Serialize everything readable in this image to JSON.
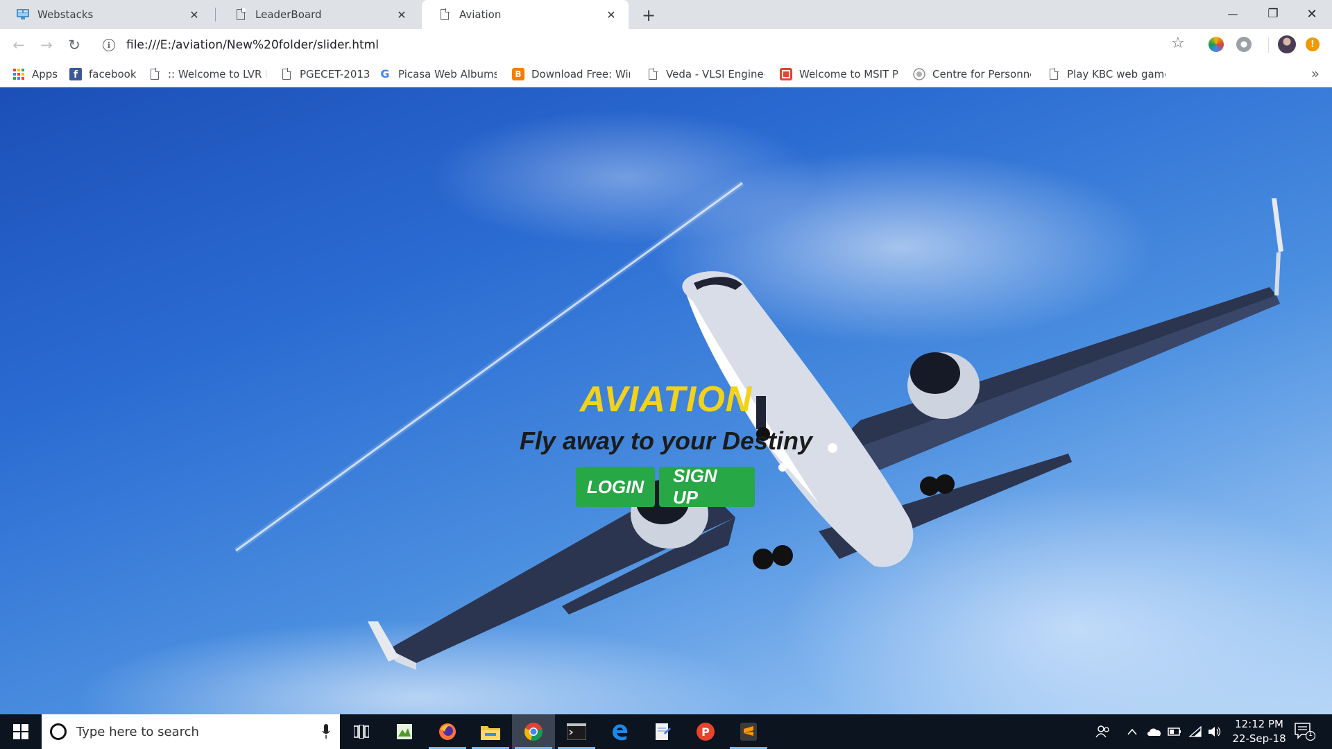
{
  "browser": {
    "tabs": [
      {
        "title": "Webstacks",
        "icon": "webstacks-favicon",
        "active": false
      },
      {
        "title": "LeaderBoard",
        "icon": "page-icon",
        "active": false
      },
      {
        "title": "Aviation",
        "icon": "page-icon",
        "active": true
      }
    ],
    "tab_close_glyph": "✕",
    "new_tab_glyph": "+",
    "window_controls": {
      "minimize": "—",
      "restore": "❐",
      "close": "✕"
    },
    "toolbar": {
      "back": "←",
      "forward": "→",
      "reload": "↻",
      "url": "file:///E:/aviation/New%20folder/slider.html",
      "info_glyph": "i",
      "star": "☆"
    },
    "bookmarks": [
      {
        "label": "Apps",
        "icon": "apps-grid-icon"
      },
      {
        "label": "facebook",
        "icon": "facebook-icon"
      },
      {
        "label": ":: Welcome to LVR BR",
        "icon": "page-icon"
      },
      {
        "label": "PGECET-2013",
        "icon": "page-icon"
      },
      {
        "label": "Picasa Web Albums: ",
        "icon": "google-icon"
      },
      {
        "label": "Download Free: Wind",
        "icon": "blogger-icon"
      },
      {
        "label": "Veda - VLSI Engineeri",
        "icon": "page-icon"
      },
      {
        "label": "Welcome to MSIT Pro",
        "icon": "msit-icon"
      },
      {
        "label": "Centre for Personnel",
        "icon": "emblem-icon"
      },
      {
        "label": "Play KBC web game c",
        "icon": "page-icon"
      }
    ],
    "bookmarks_more": "»"
  },
  "page": {
    "hero_title": "AVIATION",
    "hero_subtitle": "Fly away to your Destiny",
    "login_label": "LOGIN",
    "signup_label": "SIGN UP"
  },
  "taskbar": {
    "search_placeholder": "Type here to search",
    "time": "12:12 PM",
    "date": "22-Sep-18",
    "notification_count": "1",
    "apps": [
      "task-view-icon",
      "spreadsheet-icon",
      "firefox-icon",
      "file-explorer-icon",
      "chrome-icon",
      "terminal-icon",
      "edge-icon",
      "notepad-icon",
      "postman-icon",
      "sublime-icon"
    ]
  },
  "colors": {
    "hero_title": "#f2d21a",
    "button_green": "#27a745",
    "taskbar": "#0c1420",
    "tab_strip": "#dee1e6"
  }
}
